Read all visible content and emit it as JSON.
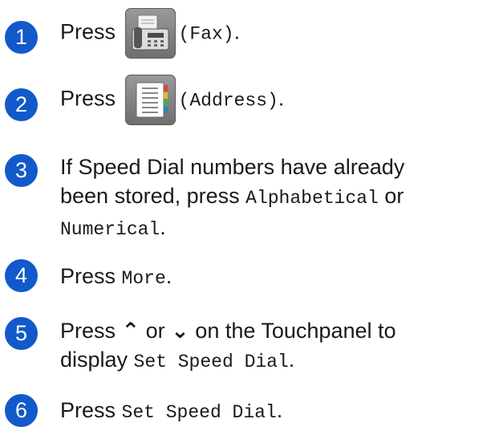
{
  "steps": [
    {
      "number": "1",
      "prefix": "Press",
      "icon": "fax-icon",
      "mono": "(Fax)",
      "suffix": "."
    },
    {
      "number": "2",
      "prefix": "Press",
      "icon": "address-book-icon",
      "mono": "(Address)",
      "suffix": "."
    },
    {
      "number": "3",
      "line1": "If Speed Dial numbers have already",
      "line2_prefix": "been stored, press ",
      "line2_mono": "Alphabetical",
      "line2_suffix": " or",
      "line3_mono": "Numerical",
      "line3_suffix": "."
    },
    {
      "number": "4",
      "prefix": "Press ",
      "mono": "More",
      "suffix": "."
    },
    {
      "number": "5",
      "prefix": "Press ",
      "up": "⌃",
      "mid": " or ",
      "down": "⌄",
      "suffix": " on the Touchpanel to",
      "line2_prefix": "display ",
      "line2_mono": "Set Speed Dial",
      "line2_suffix": "."
    },
    {
      "number": "6",
      "prefix": "Press ",
      "mono": "Set Speed Dial",
      "suffix": "."
    }
  ],
  "colors": {
    "step_badge": "#1259c9",
    "icon_button": "#808080"
  }
}
